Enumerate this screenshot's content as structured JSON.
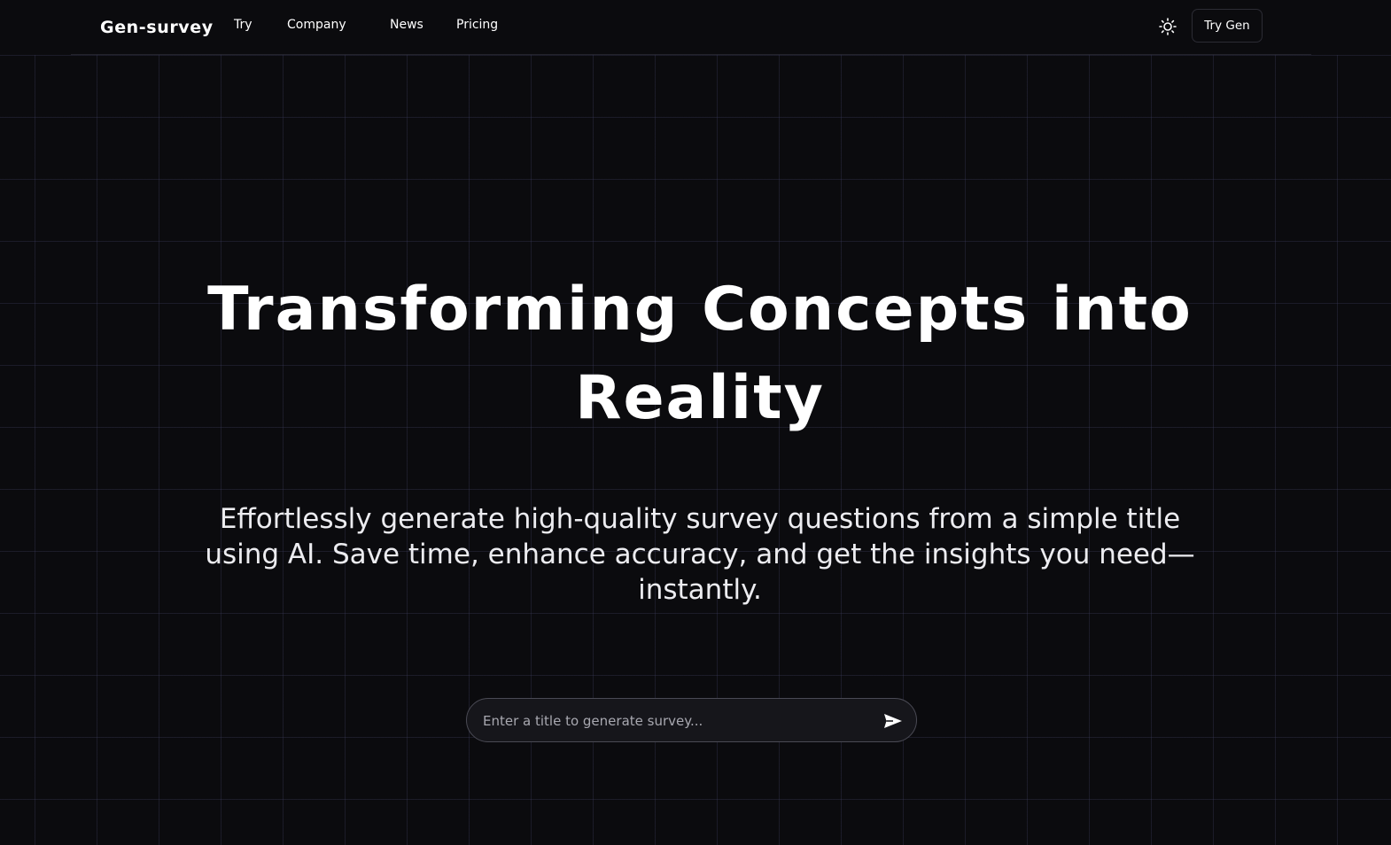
{
  "brand": {
    "name": "Gen-survey"
  },
  "nav": {
    "links": [
      {
        "label": "Try"
      },
      {
        "label": "Company"
      },
      {
        "label": "News"
      },
      {
        "label": "Pricing"
      }
    ],
    "theme_toggle_icon": "sun-icon",
    "cta_label": "Try Gen"
  },
  "hero": {
    "title_line1": "Transforming Concepts into",
    "title_line2": "Reality",
    "subtitle": "Effortlessly generate high-quality survey questions from a simple title using AI. Save time, enhance accuracy, and get the insights you need—instantly."
  },
  "search": {
    "placeholder": "Enter a title to generate survey...",
    "value": "",
    "send_icon": "send-icon"
  },
  "colors": {
    "background": "#0b0b0e",
    "text": "#ffffff",
    "grid_line": "#2a2a40",
    "border": "#2c2c34"
  }
}
